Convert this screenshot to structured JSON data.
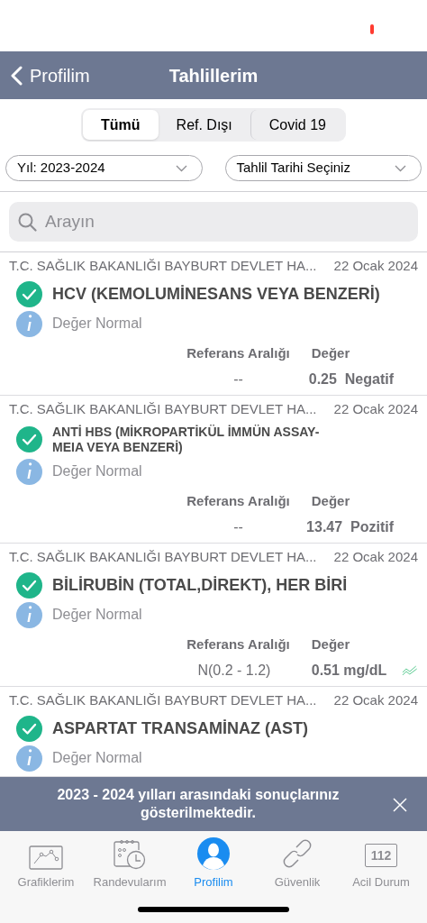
{
  "nav": {
    "back_label": "Profilim",
    "title": "Tahlillerim"
  },
  "segments": [
    {
      "label": "Tümü",
      "selected": true
    },
    {
      "label": "Ref. Dışı",
      "selected": false
    },
    {
      "label": "Covid 19",
      "selected": false
    }
  ],
  "filters": [
    {
      "value": "Yıl: 2023-2024"
    },
    {
      "value": "Tahlil Tarihi Seçiniz"
    }
  ],
  "search": {
    "placeholder": "Arayın"
  },
  "results": [
    {
      "source": "T.C. SAĞLIK BAKANLIĞI BAYBURT DEVLET HA...",
      "date": "22 Ocak 2024",
      "title": "HCV (KEMOLUMİNESANS VEYA BENZERİ)",
      "status": "Değer Normal",
      "ref_header": "Referans Aralığı",
      "value_header": "Değer",
      "ref": "--",
      "value": "0.25  Negatif",
      "trend": false
    },
    {
      "source": "T.C. SAĞLIK BAKANLIĞI BAYBURT DEVLET HA...",
      "date": "22 Ocak 2024",
      "title": "ANTİ HBS  (MİKROPARTİKÜL İMMÜN ASSAY-MEIA VEYA BENZERİ)",
      "status": "Değer Normal",
      "ref_header": "Referans Aralığı",
      "value_header": "Değer",
      "ref": "--",
      "value": "13.47  Pozitif",
      "trend": false
    },
    {
      "source": "T.C. SAĞLIK BAKANLIĞI BAYBURT DEVLET HA...",
      "date": "22 Ocak 2024",
      "title": "BİLİRUBİN (TOTAL,DİREKT), HER BİRİ",
      "status": "Değer Normal",
      "ref_header": "Referans Aralığı",
      "value_header": "Değer",
      "ref": "N(0.2 - 1.2)",
      "value": "0.51 mg/dL",
      "trend": true
    },
    {
      "source": "T.C. SAĞLIK BAKANLIĞI BAYBURT DEVLET HA...",
      "date": "22 Ocak 2024",
      "title": "ASPARTAT TRANSAMİNAZ (AST)",
      "status": "Değer Normal"
    }
  ],
  "banner": {
    "text": "2023 - 2024 yılları arasındaki sonuçlarınız gösterilmektedir."
  },
  "tabs": [
    {
      "kind": "chart",
      "label": "Grafiklerim",
      "selected": false
    },
    {
      "kind": "calendar",
      "label": "Randevularım",
      "selected": false
    },
    {
      "kind": "profile",
      "label": "Profilim",
      "selected": true
    },
    {
      "kind": "link",
      "label": "Güvenlik",
      "selected": false
    },
    {
      "kind": "emergency",
      "label": "Acil Durum",
      "badge": "112",
      "selected": false
    }
  ]
}
